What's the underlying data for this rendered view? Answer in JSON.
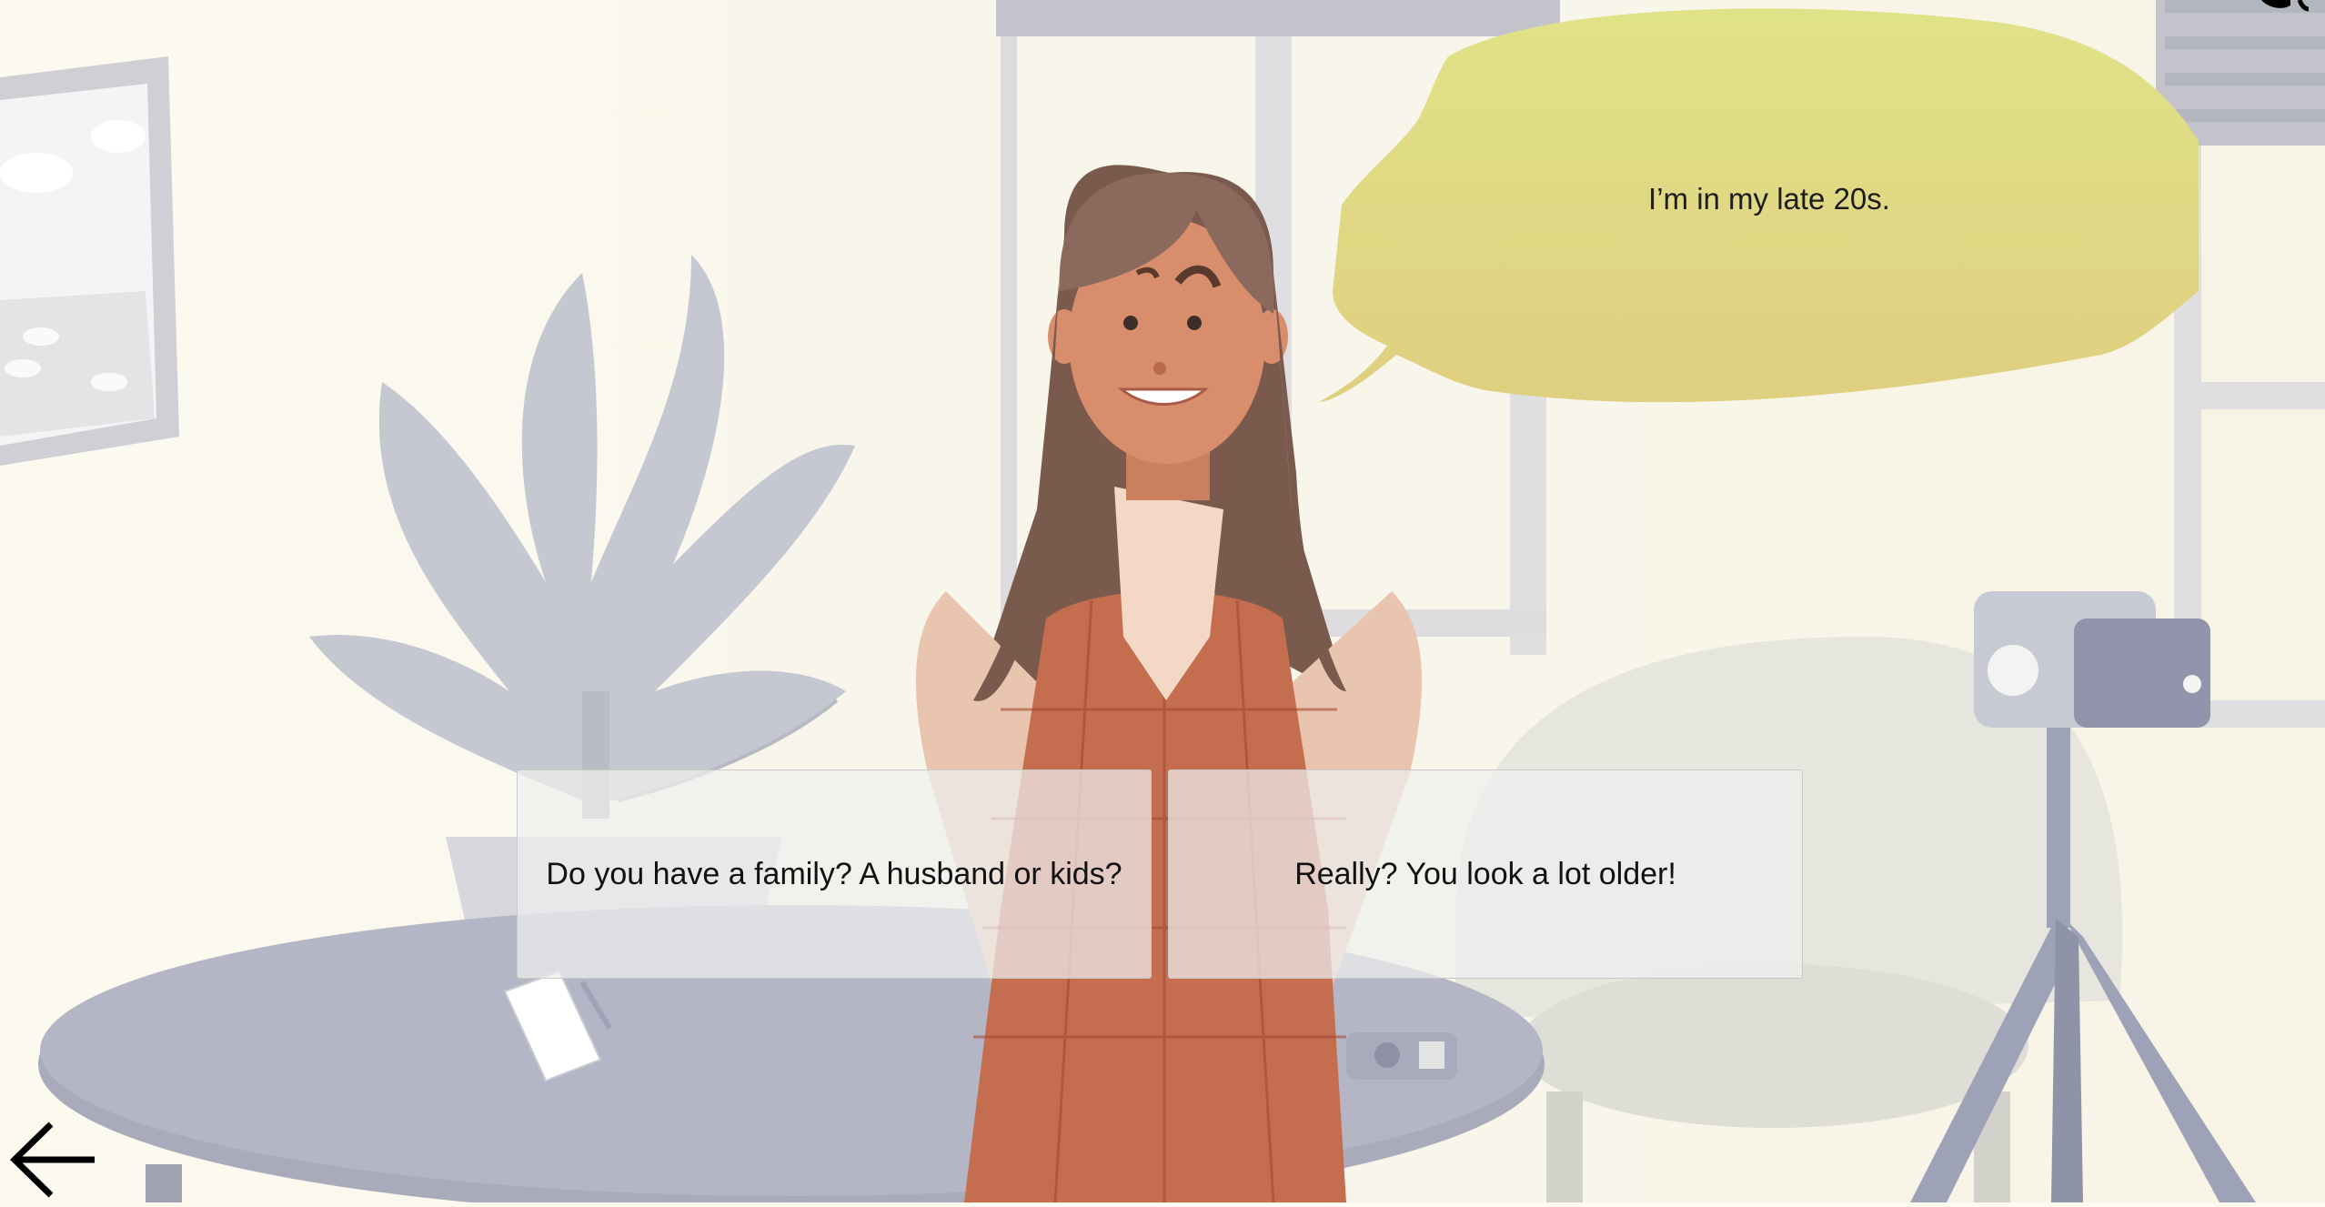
{
  "dialogue": {
    "speech": "I’m in my late 20s."
  },
  "choices": [
    {
      "label": "Do you have a family? A husband or kids?"
    },
    {
      "label": "Really? You look a lot older!"
    }
  ],
  "icons": {
    "back": "arrow-left-icon",
    "top_right": "sound-icon"
  },
  "colors": {
    "background": "#fdfbf0",
    "bubble": "#e2dd86",
    "choice_bg": "#eeeeee",
    "choice_border": "#c9c9c9"
  }
}
